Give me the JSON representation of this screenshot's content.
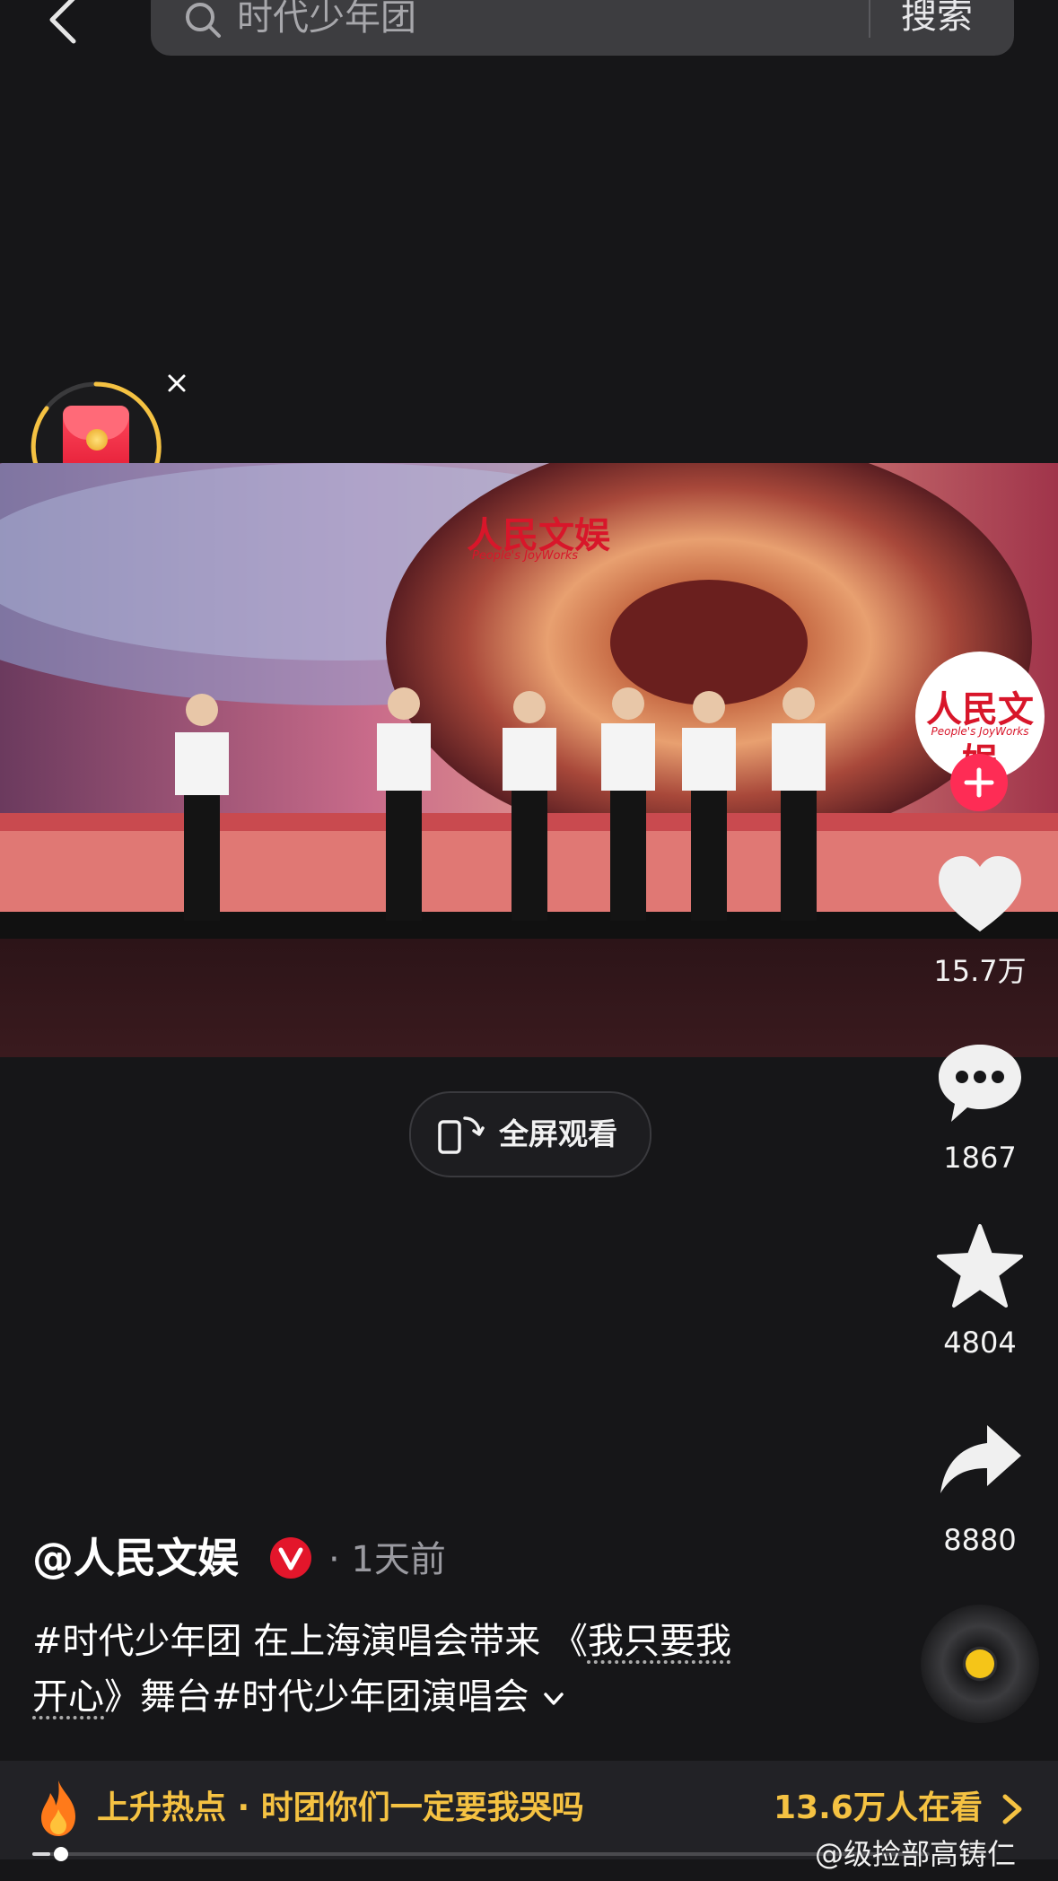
{
  "header": {
    "back_icon": "back-chevron-icon",
    "search_placeholder": "时代少年团",
    "search_button": "搜索"
  },
  "red_packet": {
    "icon": "red-packet-icon",
    "close_icon": "close-icon"
  },
  "video": {
    "watermark": "人民文娱",
    "watermark_sub": "People's JoyWorks"
  },
  "fullscreen": {
    "label": "全屏观看",
    "icon": "fullscreen-rotate-icon"
  },
  "rail": {
    "avatar_logo": "人民文娱",
    "avatar_logo_sub": "People's JoyWorks",
    "follow_icon": "plus-icon",
    "likes": "15.7万",
    "comments": "1867",
    "favorites": "4804",
    "shares": "8880"
  },
  "post": {
    "author": "@人民文娱",
    "time_ago": "· 1天前",
    "caption_part1": "#时代少年团 在上海演唱会带来 《",
    "caption_song_a": "我只要我",
    "caption_song_b": "开心",
    "caption_part2": "》舞台#时代少年团演唱会"
  },
  "hot_bar": {
    "text": "上升热点 · 时团你们一定要我哭吗",
    "viewers": "13.6万人在看"
  },
  "progress": {
    "fraction": 0.02
  },
  "weibo_watermark": "@级捡部高铸仁",
  "colors": {
    "background": "#161618",
    "accent_red": "#fe2c55",
    "hot_yellow": "#f5c242",
    "verified_red": "#e3162b"
  }
}
